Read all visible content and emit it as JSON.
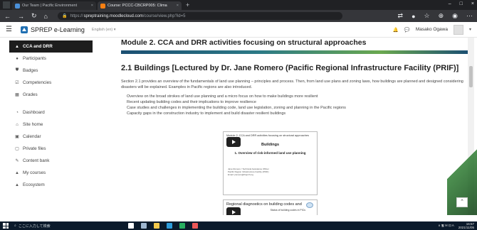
{
  "browser": {
    "tabs": [
      {
        "label": "Our Team | Pacific Environment",
        "active": false,
        "favicon_color": "#4a90d9"
      },
      {
        "label": "Course: PCCC-CBCRP005: Clima",
        "active": true,
        "favicon_color": "#f98012"
      }
    ],
    "new_tab": "+",
    "window_controls": [
      "–",
      "□",
      "×"
    ],
    "url": {
      "scheme": "https://",
      "host": "spreptraining.moodlecloud.com",
      "path": "/course/view.php?id=5"
    }
  },
  "header": {
    "menu_icon": "hamburger-icon",
    "site_name": "SPREP e-Learning",
    "language": "English (en) ▾",
    "user_name": "Masako Ogawa",
    "caret": "▾"
  },
  "sidebar": {
    "items": [
      {
        "label": "CCA and DRR",
        "icon": "mortarboard-icon",
        "glyph": "🎓",
        "active": true
      },
      {
        "label": "Participants",
        "icon": "users-icon",
        "glyph": "👥",
        "active": false
      },
      {
        "label": "Badges",
        "icon": "shield-icon",
        "glyph": "⛊",
        "active": false
      },
      {
        "label": "Competencies",
        "icon": "checkbox-icon",
        "glyph": "☑",
        "active": false
      },
      {
        "label": "Grades",
        "icon": "table-icon",
        "glyph": "▦",
        "active": false
      }
    ],
    "items2": [
      {
        "label": "Dashboard",
        "icon": "dashboard-icon",
        "glyph": "◔"
      },
      {
        "label": "Site home",
        "icon": "home-icon",
        "glyph": "⌂"
      },
      {
        "label": "Calendar",
        "icon": "calendar-icon",
        "glyph": "▣"
      },
      {
        "label": "Private files",
        "icon": "file-icon",
        "glyph": "▢"
      },
      {
        "label": "Content bank",
        "icon": "brush-icon",
        "glyph": "✎"
      },
      {
        "label": "My courses",
        "icon": "mortarboard-icon",
        "glyph": "🎓"
      },
      {
        "label": "Ecosystem",
        "icon": "mortarboard-icon",
        "glyph": "🎓"
      }
    ]
  },
  "main": {
    "module_title": "Module 2. CCA and DRR activities focusing on structural approaches",
    "section_title": "2.1 Buildings [Lectured by Dr. Jane Romero (Pacific Regional Infrastructure Facility (PRIF)]",
    "intro": "Section 2.1 provides an overview of the fundamentals of land use planning – principles and process. Then, from land use plans and zoning laws, how buildings are planned and designed considering disasters will be explained. Examples in Pacific regions are also introduced.",
    "bullets": [
      "Overview on the broad strokes of land use planning and a micro focus on how to make buildings more resilient",
      "Recent updating building codes and their implications to improve resilience",
      "Case studies and challenges in implementing the building code, land use legislation, zoning and planning in the Pacific regions",
      "Capacity gaps in the construction industry to implement and build disaster resilient buildings"
    ],
    "slide1": {
      "top_text": "Module 2: CCA and DRR activities focusing on structural approaches",
      "heading": "Buildings",
      "subheading": "1. Overview of risk-informed land use planning",
      "footer": [
        "Jane Romero / Technical Assistance Officer",
        "Pacific Region Infrastructure Facility (PRIF)",
        "Email: jromero@theprif.org"
      ]
    },
    "slide2": {
      "heading": "Regional diagnostics on building codes and",
      "stat": "Status of building codes in PICs"
    }
  },
  "taskbar": {
    "search_placeholder": "ここに入力して検索",
    "apps": [
      {
        "name": "search-app-icon",
        "color": "#ffffff"
      },
      {
        "name": "taskview-icon",
        "color": "#9fb7d0"
      },
      {
        "name": "explorer-icon",
        "color": "#f2c94c"
      },
      {
        "name": "edge-icon",
        "color": "#2d9cdb"
      },
      {
        "name": "chrome-icon",
        "color": "#27ae60"
      },
      {
        "name": "mail-icon",
        "color": "#eb5757"
      }
    ],
    "tray": "∧ 🖫 ✉ ⊡ A",
    "time": "16:57",
    "date": "2021/11/05"
  }
}
